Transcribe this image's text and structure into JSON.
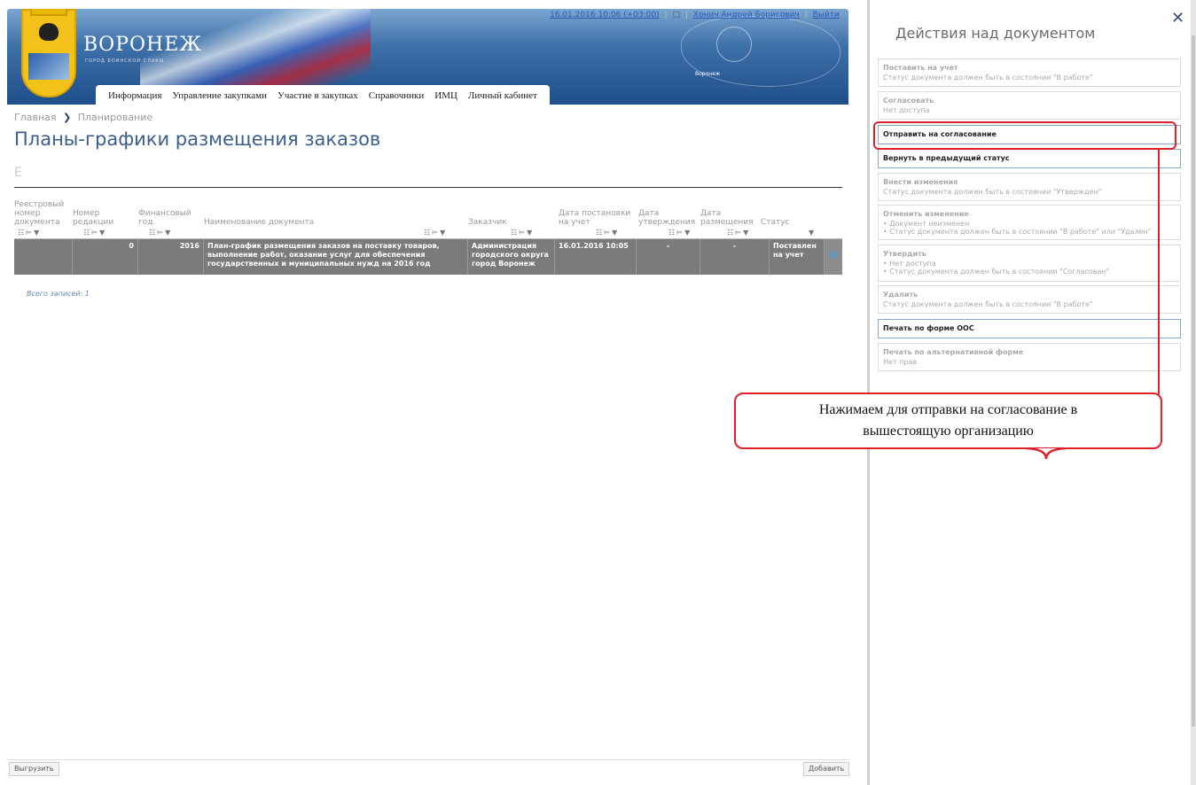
{
  "topbar": {
    "datetime": "16.01.2016 10:06 (+03:00)",
    "user": "Хонич Андрей Борисович",
    "logout": "Выйти"
  },
  "brand": {
    "name": "ВОРОНЕЖ",
    "subtitle": "ГОРОД ВОИНСКОЙ СЛАВЫ",
    "map_label": "Воронеж"
  },
  "nav": [
    "Информация",
    "Управление закупками",
    "Участие в закупках",
    "Справочники",
    "ИМЦ",
    "Личный кабинет"
  ],
  "breadcrumb": {
    "home": "Главная",
    "section": "Планирование"
  },
  "page_title": "Планы-графики размещения заказов",
  "toolbar_mark": "E",
  "columns": [
    {
      "key": "reg_no",
      "label": "Реестровый номер документа"
    },
    {
      "key": "rev_no",
      "label": "Номер редакции"
    },
    {
      "key": "fin_year",
      "label": "Финансовый год"
    },
    {
      "key": "doc_name",
      "label": "Наименование документа"
    },
    {
      "key": "customer",
      "label": "Заказчик"
    },
    {
      "key": "reg_date",
      "label": "Дата постановки на учет"
    },
    {
      "key": "approve_date",
      "label": "Дата утверждения"
    },
    {
      "key": "publish_date",
      "label": "Дата размещения"
    },
    {
      "key": "status",
      "label": "Статус"
    }
  ],
  "rows": [
    {
      "reg_no": "",
      "rev_no": "0",
      "fin_year": "2016",
      "doc_name": "План-график размещения заказов на поставку товаров, выполнение работ, оказание услуг для обеспечения государственных и муниципальных нужд на 2016 год",
      "customer": "Администрация городского округа город Воронеж",
      "reg_date": "16.01.2016 10:05",
      "approve_date": "-",
      "publish_date": "-",
      "status": "Поставлен на учет"
    }
  ],
  "total": "Всего записей: 1",
  "bottom": {
    "export": "Выгрузить",
    "add": "Добавить"
  },
  "panel": {
    "title": "Действия над документом",
    "close": "✕",
    "actions": [
      {
        "title": "Поставить на учет",
        "note": "Статус документа должен быть в состоянии \"В работе\""
      },
      {
        "title": "Согласовать",
        "note": "Нет доступа"
      },
      {
        "title": "Отправить на согласование"
      },
      {
        "title": "Вернуть в предыдущий статус"
      },
      {
        "title": "Внести изменения",
        "note": "Статус документа должен быть в состоянии \"Утвержден\""
      },
      {
        "title": "Отменить изменение",
        "items": [
          "Документ неизменен",
          "Статус документа должен быть в состоянии \"В работе\" или \"Удален\""
        ]
      },
      {
        "title": "Утвердить",
        "items": [
          "Нет доступа",
          "Статус документа должен быть в состоянии \"Согласован\""
        ]
      },
      {
        "title": "Удалить",
        "note": "Статус документа должен быть в состоянии \"В работе\""
      },
      {
        "title": "Печать по форме ООС"
      },
      {
        "title": "Печать по альтернативной форме",
        "note": "Нет прав"
      }
    ]
  },
  "callout": {
    "line1": "Нажимаем для отправки на согласование в",
    "line2": "вышестоящую организацию"
  },
  "colors": {
    "highlight": "#e0202a",
    "header_blue": "#2f5f9a",
    "row_bg": "#7b7b7b"
  }
}
